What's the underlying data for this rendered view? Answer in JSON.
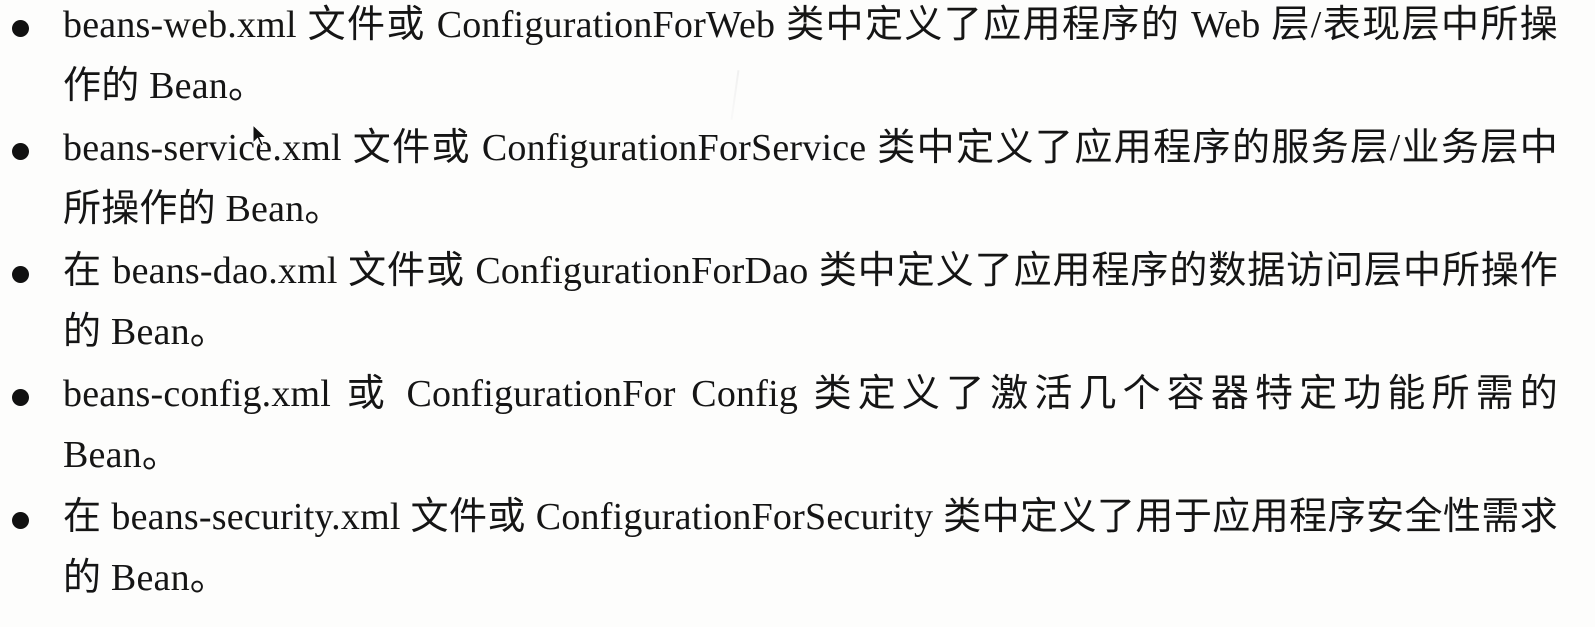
{
  "items": [
    {
      "text": "beans-web.xml 文件或 ConfigurationForWeb 类中定义了应用程序的 Web 层/表现层中所操作的 Bean。"
    },
    {
      "text": "beans-service.xml 文件或 ConfigurationForService 类中定义了应用程序的服务层/业务层中所操作的 Bean。"
    },
    {
      "text": "在 beans-dao.xml 文件或 ConfigurationForDao 类中定义了应用程序的数据访问层中所操作的 Bean。"
    },
    {
      "text": "beans-config.xml 或 ConfigurationFor Config 类定义了激活几个容器特定功能所需的 Bean。"
    },
    {
      "text": "在 beans-security.xml 文件或 ConfigurationForSecurity 类中定义了用于应用程序安全性需求的 Bean。"
    }
  ],
  "icons": {
    "cursor": "mouse-pointer-icon"
  }
}
